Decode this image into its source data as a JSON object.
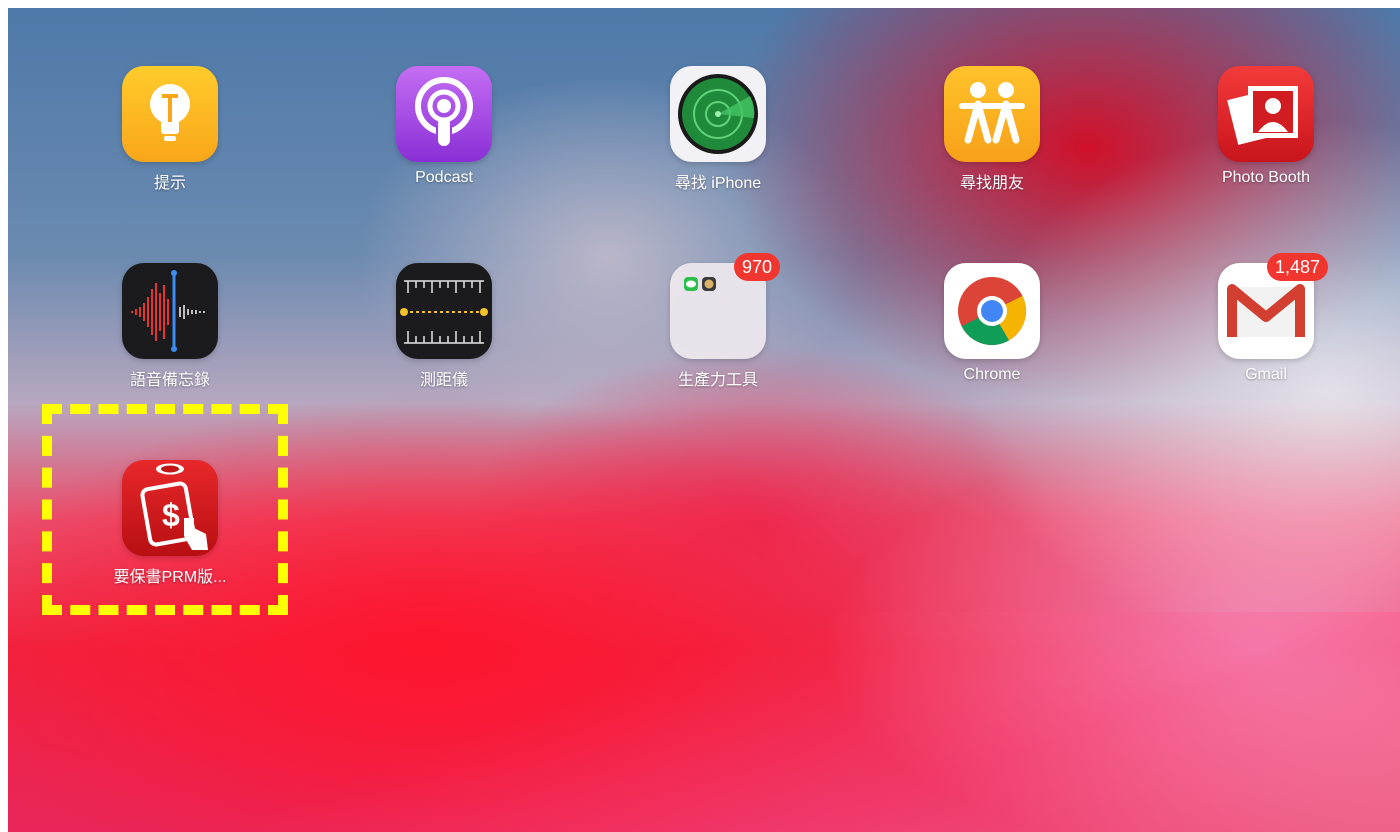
{
  "apps": [
    {
      "label": "提示"
    },
    {
      "label": "Podcast"
    },
    {
      "label": "尋找 iPhone"
    },
    {
      "label": "尋找朋友"
    },
    {
      "label": "Photo Booth"
    },
    {
      "label": "語音備忘錄"
    },
    {
      "label": "測距儀"
    },
    {
      "label": "生產力工具",
      "badge": "970"
    },
    {
      "label": "Chrome"
    },
    {
      "label": "Gmail",
      "badge": "1,487"
    },
    {
      "label": "要保書PRM版..."
    }
  ],
  "colors": {
    "highlight": "#ffff00",
    "badge": "#f0362f"
  }
}
